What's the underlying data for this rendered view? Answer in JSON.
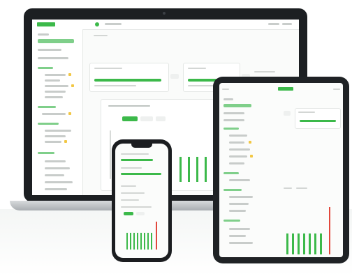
{
  "scene": {
    "accent_color": "#3cb94a",
    "alert_color": "#e2483c",
    "tag_color": "#f2c744",
    "background_color": "#ffffff"
  },
  "devices": {
    "laptop": {
      "name": "laptop",
      "screen_label": "dashboard"
    },
    "tablet": {
      "name": "tablet",
      "screen_label": "dashboard"
    },
    "phone": {
      "name": "phone",
      "screen_label": "dashboard"
    }
  },
  "icons": [
    "camera-icon",
    "logo-icon",
    "notch"
  ]
}
